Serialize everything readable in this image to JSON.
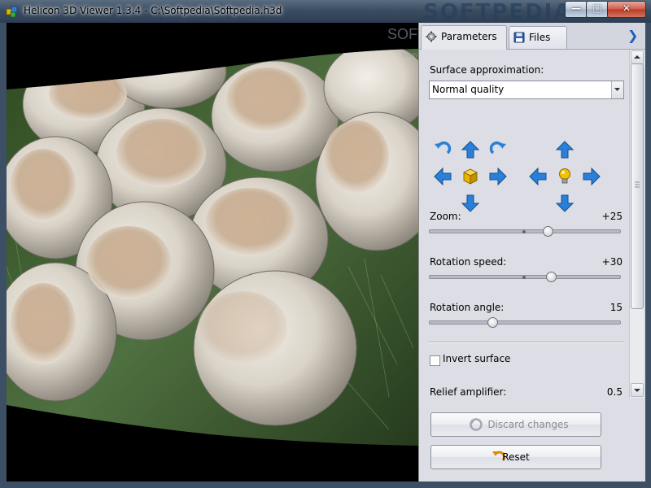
{
  "window": {
    "title": "Helicon 3D Viewer 1.3.4 - C:\\Softpedia\\Softpedia.h3d",
    "watermark": "SOFTPEDIA",
    "controls": [
      "minimize",
      "maximize",
      "close"
    ]
  },
  "viewer": {
    "watermark": "SOFTPEDIA",
    "watermark_url": "www.softpedia.com"
  },
  "tabs": {
    "parameters_label": "Parameters",
    "files_label": "Files",
    "active": "Parameters"
  },
  "parameters": {
    "surface_label": "Surface approximation:",
    "surface_value": "Normal quality",
    "zoom_label": "Zoom:",
    "zoom_value": "+25",
    "rotation_speed_label": "Rotation speed:",
    "rotation_speed_value": "+30",
    "rotation_angle_label": "Rotation angle:",
    "rotation_angle_value": "15",
    "invert_label": "Invert surface",
    "invert_checked": false,
    "relief_label": "Relief amplifier:",
    "relief_value": "0.5"
  },
  "sliders": {
    "zoom_fraction": 0.62,
    "rotation_speed_fraction": 0.64,
    "rotation_angle_fraction": 0.33
  },
  "buttons": {
    "discard_label": "Discard changes",
    "discard_enabled": false,
    "reset_label": "Reset"
  },
  "icons": {
    "object_controls": [
      "rotate-left-icon",
      "arrow-up-icon",
      "rotate-right-icon",
      "arrow-left-icon",
      "cube-icon",
      "arrow-right-icon",
      "arrow-down-icon"
    ],
    "light_controls": [
      "arrow-up-icon",
      "arrow-left-icon",
      "light-bulb-icon",
      "arrow-right-icon",
      "arrow-down-icon"
    ]
  },
  "colors": {
    "accent_blue": "#2a7fd8",
    "cube_yellow": "#e8b400",
    "bulb_yellow": "#f2c200"
  }
}
